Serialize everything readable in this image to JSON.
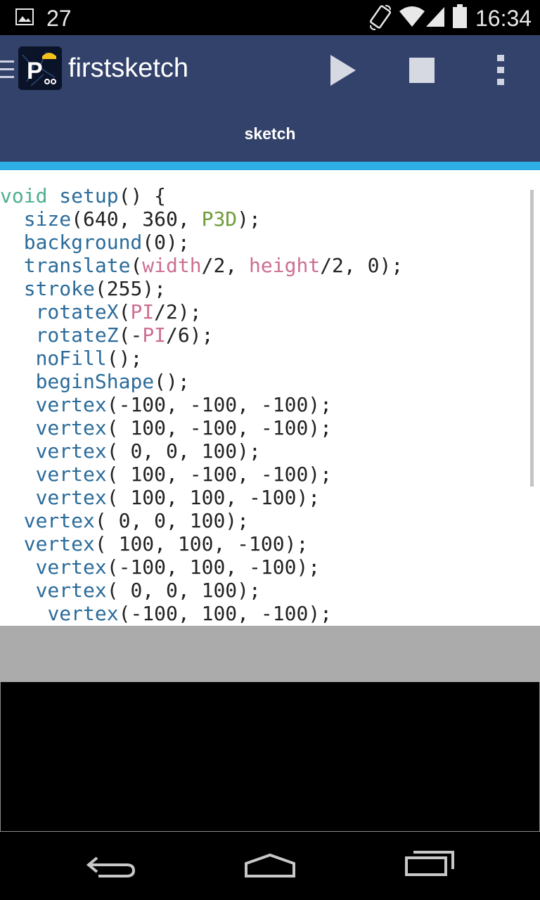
{
  "status_bar": {
    "notification_count": "27",
    "time": "16:34"
  },
  "app": {
    "title": "firstsketch",
    "tab_label": "sketch"
  },
  "editor": {
    "lines": [
      [
        {
          "t": "void ",
          "c": "kw"
        },
        {
          "t": "setup",
          "c": "fn"
        },
        {
          "t": "() {",
          "c": ""
        }
      ],
      [
        {
          "t": "  ",
          "c": ""
        },
        {
          "t": "size",
          "c": "fn"
        },
        {
          "t": "(640, 360, ",
          "c": ""
        },
        {
          "t": "P3D",
          "c": "str3d"
        },
        {
          "t": ");",
          "c": ""
        }
      ],
      [
        {
          "t": "  ",
          "c": ""
        },
        {
          "t": "background",
          "c": "fn"
        },
        {
          "t": "(0);",
          "c": ""
        }
      ],
      [
        {
          "t": "  ",
          "c": ""
        },
        {
          "t": "translate",
          "c": "fn"
        },
        {
          "t": "(",
          "c": ""
        },
        {
          "t": "width",
          "c": "const"
        },
        {
          "t": "/2, ",
          "c": ""
        },
        {
          "t": "height",
          "c": "const"
        },
        {
          "t": "/2, 0);",
          "c": ""
        }
      ],
      [
        {
          "t": "  ",
          "c": ""
        },
        {
          "t": "stroke",
          "c": "fn"
        },
        {
          "t": "(255);",
          "c": ""
        }
      ],
      [
        {
          "t": "   ",
          "c": ""
        },
        {
          "t": "rotateX",
          "c": "fn"
        },
        {
          "t": "(",
          "c": ""
        },
        {
          "t": "PI",
          "c": "const"
        },
        {
          "t": "/2);",
          "c": ""
        }
      ],
      [
        {
          "t": "   ",
          "c": ""
        },
        {
          "t": "rotateZ",
          "c": "fn"
        },
        {
          "t": "(-",
          "c": ""
        },
        {
          "t": "PI",
          "c": "const"
        },
        {
          "t": "/6);",
          "c": ""
        }
      ],
      [
        {
          "t": "   ",
          "c": ""
        },
        {
          "t": "noFill",
          "c": "fn"
        },
        {
          "t": "();",
          "c": ""
        }
      ],
      [
        {
          "t": "   ",
          "c": ""
        },
        {
          "t": "beginShape",
          "c": "fn"
        },
        {
          "t": "();",
          "c": ""
        }
      ],
      [
        {
          "t": "   ",
          "c": ""
        },
        {
          "t": "vertex",
          "c": "fn"
        },
        {
          "t": "(-100, -100, -100);",
          "c": ""
        }
      ],
      [
        {
          "t": "   ",
          "c": ""
        },
        {
          "t": "vertex",
          "c": "fn"
        },
        {
          "t": "( 100, -100, -100);",
          "c": ""
        }
      ],
      [
        {
          "t": "   ",
          "c": ""
        },
        {
          "t": "vertex",
          "c": "fn"
        },
        {
          "t": "( 0, 0, 100);",
          "c": ""
        }
      ],
      [
        {
          "t": "   ",
          "c": ""
        },
        {
          "t": "vertex",
          "c": "fn"
        },
        {
          "t": "( 100, -100, -100);",
          "c": ""
        }
      ],
      [
        {
          "t": "   ",
          "c": ""
        },
        {
          "t": "vertex",
          "c": "fn"
        },
        {
          "t": "( 100, 100, -100);",
          "c": ""
        }
      ],
      [
        {
          "t": "  ",
          "c": ""
        },
        {
          "t": "vertex",
          "c": "fn"
        },
        {
          "t": "( 0, 0, 100);",
          "c": ""
        }
      ],
      [
        {
          "t": "  ",
          "c": ""
        },
        {
          "t": "vertex",
          "c": "fn"
        },
        {
          "t": "( 100, 100, -100);",
          "c": ""
        }
      ],
      [
        {
          "t": "   ",
          "c": ""
        },
        {
          "t": "vertex",
          "c": "fn"
        },
        {
          "t": "(-100, 100, -100);",
          "c": ""
        }
      ],
      [
        {
          "t": "   ",
          "c": ""
        },
        {
          "t": "vertex",
          "c": "fn"
        },
        {
          "t": "( 0, 0, 100);",
          "c": ""
        }
      ],
      [
        {
          "t": "    ",
          "c": ""
        },
        {
          "t": "vertex",
          "c": "fn"
        },
        {
          "t": "(-100, 100, -100);",
          "c": ""
        }
      ]
    ]
  },
  "colors": {
    "action_bar": "#33426b",
    "tab_indicator": "#2eb0e4",
    "keyword": "#4cb08e",
    "function": "#2a6b9a",
    "constant": "#cc6f92",
    "renderer": "#6f9c3a"
  },
  "icons": {
    "status": [
      "gallery-icon",
      "rotate-icon",
      "wifi-icon",
      "signal-icon",
      "battery-icon"
    ],
    "toolbar": [
      "drawer-icon",
      "app-logo",
      "play-icon",
      "stop-icon",
      "overflow-menu-icon"
    ],
    "nav": [
      "back-icon",
      "home-icon",
      "recents-icon"
    ]
  }
}
